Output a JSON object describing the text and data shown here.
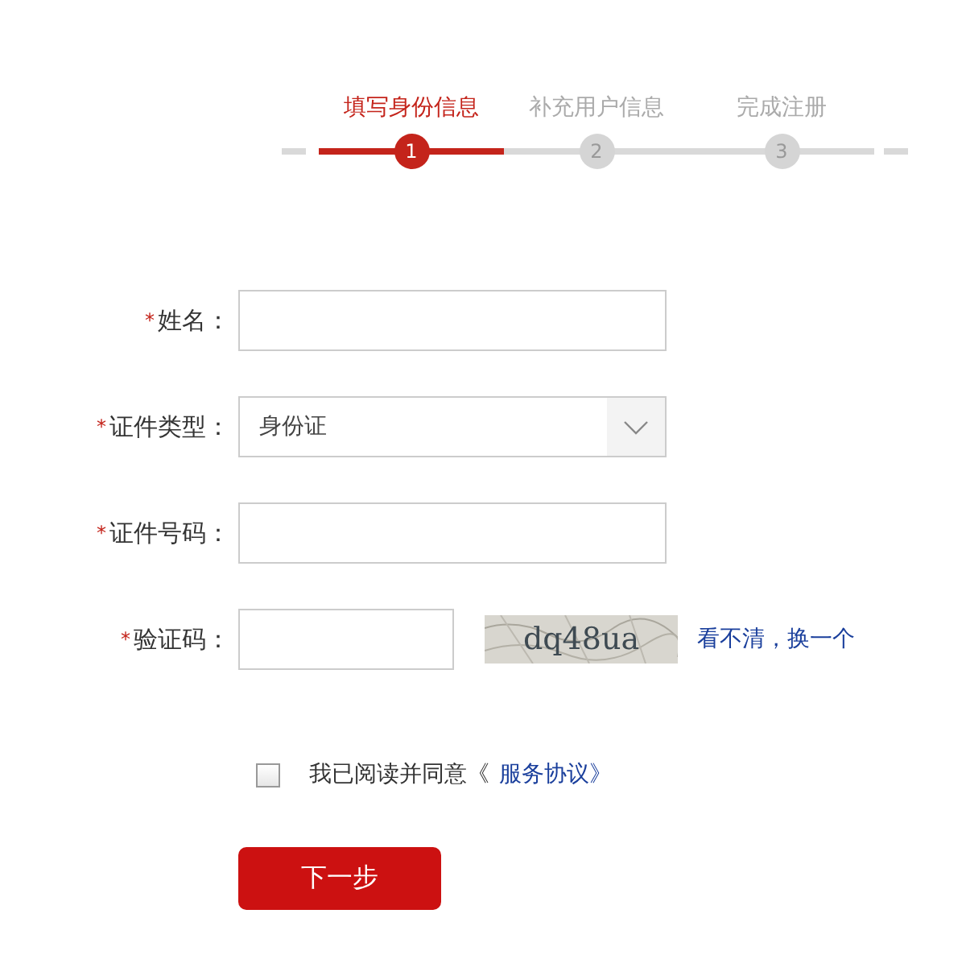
{
  "steps": [
    {
      "label": "填写身份信息",
      "number": "1",
      "selected": true
    },
    {
      "label": "补充用户信息",
      "number": "2",
      "selected": false
    },
    {
      "label": "完成注册",
      "number": "3",
      "selected": false
    }
  ],
  "fields": [
    {
      "kind": "text",
      "required_mark": "*",
      "label": "姓名："
    },
    {
      "kind": "select",
      "required_mark": "*",
      "label": "证件类型：",
      "value": "身份证"
    },
    {
      "kind": "text",
      "required_mark": "*",
      "label": "证件号码："
    },
    {
      "kind": "captcha",
      "required_mark": "*",
      "label": "验证码：",
      "captcha": "dq48ua",
      "refresh_link": "看不清，换一个"
    }
  ],
  "agreement": {
    "checked": false,
    "text": "我已阅读并同意《",
    "link": "服务协议》"
  },
  "next_button": "下一步"
}
